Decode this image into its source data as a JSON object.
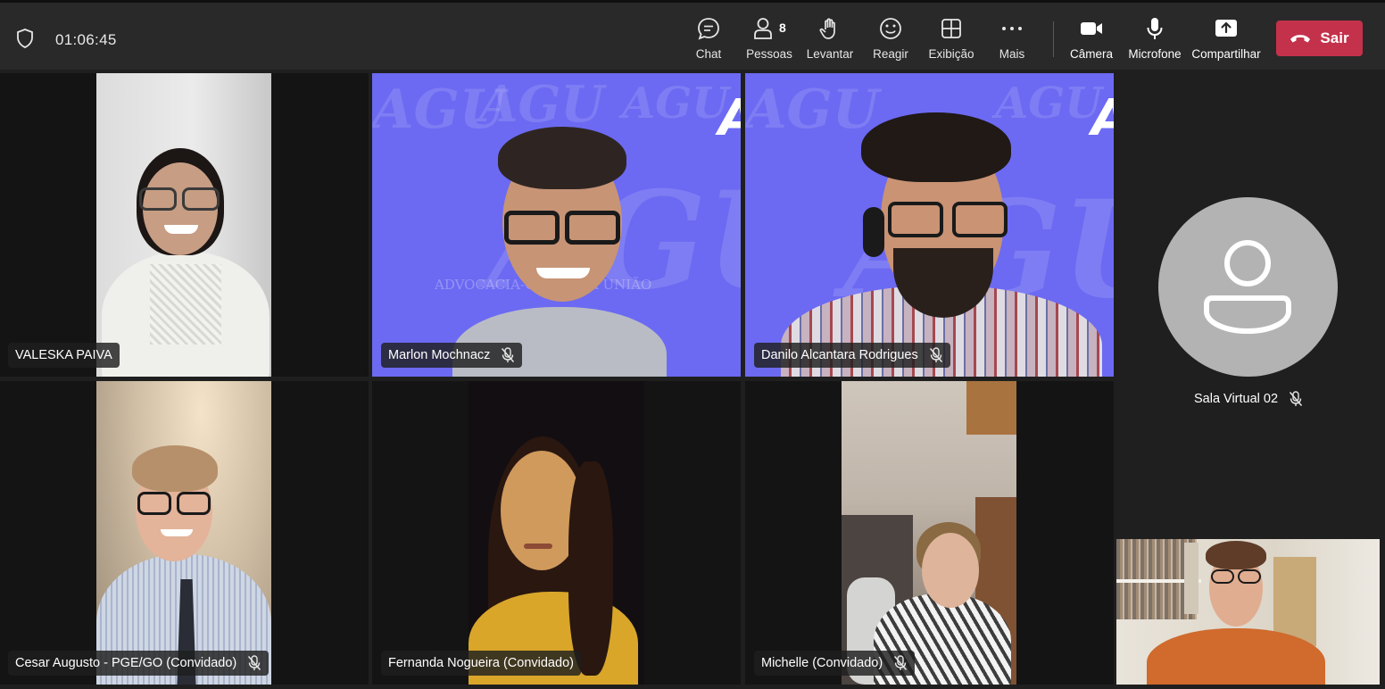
{
  "meeting": {
    "elapsed_time": "01:06:45"
  },
  "toolbar": {
    "chat_label": "Chat",
    "people_label": "Pessoas",
    "people_count": "8",
    "raise_label": "Levantar",
    "react_label": "Reagir",
    "view_label": "Exibição",
    "more_label": "Mais",
    "camera_label": "Câmera",
    "mic_label": "Microfone",
    "share_label": "Compartilhar",
    "leave_label": "Sair"
  },
  "participants": [
    {
      "name": "VALESKA PAIVA",
      "muted": false
    },
    {
      "name": "Marlon Mochnacz",
      "muted": true
    },
    {
      "name": "Danilo Alcantara Rodrigues",
      "muted": true
    },
    {
      "name": "Sala Virtual 02",
      "muted": true
    },
    {
      "name": "Cesar Augusto - PGE/GO (Convidado)",
      "muted": true
    },
    {
      "name": "Fernanda Nogueira (Convidado)",
      "muted": false
    },
    {
      "name": "Michelle (Convidado)",
      "muted": true
    }
  ],
  "background_brand": {
    "logo_text": "AGU",
    "caption": "ADVOCACIA-GERAL DA UNIÃO"
  },
  "colors": {
    "leave_button": "#c4314b",
    "agu_background": "#6c6af2",
    "toolbar": "#292929",
    "stage": "#1f1f1f"
  }
}
